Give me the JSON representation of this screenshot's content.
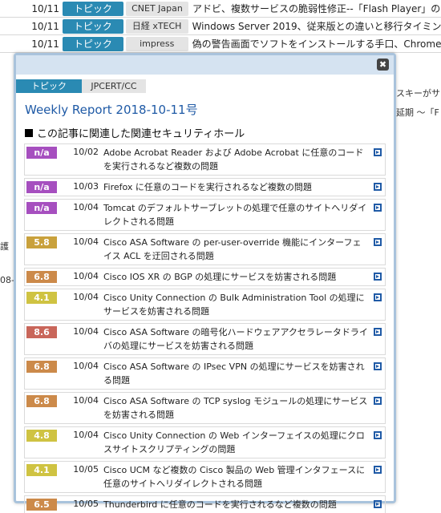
{
  "background": {
    "rows": [
      {
        "date": "10/11",
        "tag": "トピック",
        "source": "CNET Japan",
        "title": "アドビ、複数サービスの脆弱性修正--「Flash Player」の"
      },
      {
        "date": "10/11",
        "tag": "トピック",
        "source": "日経 xTECH",
        "title": "Windows Server 2019、従来版との違いと移行タイミン"
      },
      {
        "date": "10/11",
        "tag": "トピック",
        "source": "impress",
        "title": "偽の警告画面でソフトをインストールする手口、Chrome"
      }
    ],
    "fragments": [
      "スキーがサー",
      "延期 〜「F",
      "護",
      "08-"
    ]
  },
  "dialog": {
    "close_label": "✖",
    "tab_label": "トピック",
    "source_label": "JPCERT/CC",
    "report_title": "Weekly Report 2018-10-11号",
    "section_title": "この記事に関連した関連セキュリティホール",
    "items": [
      {
        "score": "n/a",
        "color": "#a64fbf",
        "date": "10/02",
        "text": "Adobe Acrobat Reader および Adobe Acrobat に任意のコードを実行されるなど複数の問題"
      },
      {
        "score": "n/a",
        "color": "#a64fbf",
        "date": "10/03",
        "text": "Firefox に任意のコードを実行されるなど複数の問題"
      },
      {
        "score": "n/a",
        "color": "#a64fbf",
        "date": "10/04",
        "text": "Tomcat のデフォルトサーブレットの処理で任意のサイトへリダイレクトされる問題"
      },
      {
        "score": "5.8",
        "color": "#c9a13c",
        "date": "10/04",
        "text": "Cisco ASA Software の per-user-override 機能にインターフェイス ACL を迂回される問題"
      },
      {
        "score": "6.8",
        "color": "#cc8a4a",
        "date": "10/04",
        "text": "Cisco IOS XR の BGP の処理にサービスを妨害される問題"
      },
      {
        "score": "4.1",
        "color": "#cfc342",
        "date": "10/04",
        "text": "Cisco Unity Connection の Bulk Administration Tool の処理にサービスを妨害される問題"
      },
      {
        "score": "8.6",
        "color": "#c9665a",
        "date": "10/04",
        "text": "Cisco ASA Software の暗号化ハードウェアアクセラレータドライバの処理にサービスを妨害される問題"
      },
      {
        "score": "6.8",
        "color": "#cc8a4a",
        "date": "10/04",
        "text": "Cisco ASA Software の IPsec VPN の処理にサービスを妨害される問題"
      },
      {
        "score": "6.8",
        "color": "#cc8a4a",
        "date": "10/04",
        "text": "Cisco ASA Software の TCP syslog モジュールの処理にサービスを妨害される問題"
      },
      {
        "score": "4.8",
        "color": "#cfc342",
        "date": "10/04",
        "text": "Cisco Unity Connection の Web インターフェイスの処理にクロスサイトスクリプティングの問題"
      },
      {
        "score": "4.1",
        "color": "#cfc342",
        "date": "10/05",
        "text": "Cisco UCM など複数の Cisco 製品の Web 管理インタフェースに任意のサイトへリダイレクトされる問題"
      },
      {
        "score": "6.5",
        "color": "#cc8a4a",
        "date": "10/05",
        "text": "Thunderbird に任意のコードを実行されるなど複数の問題"
      }
    ]
  }
}
